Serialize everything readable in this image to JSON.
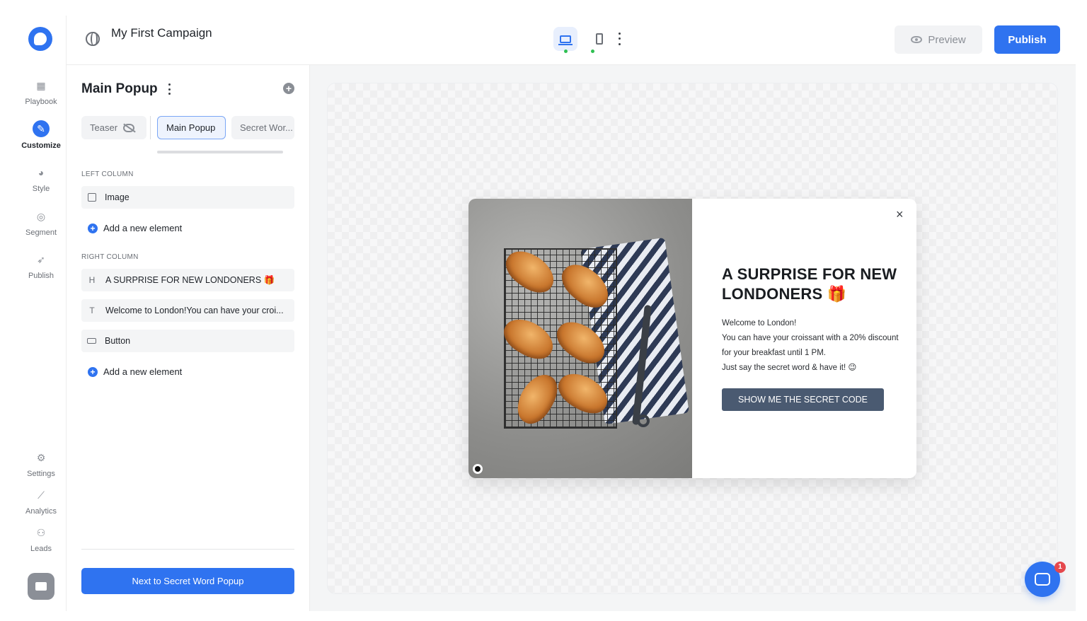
{
  "topbar": {
    "campaign_title": "My First Campaign",
    "preview_label": "Preview",
    "publish_label": "Publish"
  },
  "rail": {
    "items": [
      {
        "label": "Playbook",
        "icon": "grid-icon"
      },
      {
        "label": "Customize",
        "icon": "pencil-icon",
        "active": true
      },
      {
        "label": "Style",
        "icon": "palette-icon"
      },
      {
        "label": "Segment",
        "icon": "target-icon"
      },
      {
        "label": "Publish",
        "icon": "rocket-icon"
      },
      {
        "label": "Settings",
        "icon": "gear-icon"
      },
      {
        "label": "Analytics",
        "icon": "chart-line-icon"
      },
      {
        "label": "Leads",
        "icon": "users-icon"
      }
    ]
  },
  "panel": {
    "title": "Main Popup",
    "tabs": [
      {
        "label": "Teaser"
      },
      {
        "label": "Main Popup",
        "active": true
      },
      {
        "label": "Secret Wor..."
      }
    ],
    "left_column_label": "LEFT COLUMN",
    "left_elements": [
      {
        "label": "Image",
        "type": "image"
      }
    ],
    "add_element_label": "Add a new element",
    "right_column_label": "RIGHT COLUMN",
    "right_elements": [
      {
        "label": "A SURPRISE FOR NEW LONDONERS 🎁",
        "type": "heading",
        "icon": "H"
      },
      {
        "label": "Welcome to London!You can have your croi...",
        "type": "text",
        "icon": "T"
      },
      {
        "label": "Button",
        "type": "button"
      }
    ],
    "next_button_label": "Next to Secret Word Popup"
  },
  "popup": {
    "heading": "A SURPRISE FOR NEW LONDONERS 🎁",
    "body_lines": [
      "Welcome to London!",
      "You can have your croissant with a 20% discount for your breakfast until 1 PM.",
      "Just say the secret word & have it! 😉"
    ],
    "cta_label": "SHOW ME THE SECRET CODE",
    "close_glyph": "×"
  },
  "chat": {
    "badge_count": "1"
  },
  "colors": {
    "accent": "#2f73f0",
    "cta_bg": "#4a5a71",
    "status_green": "#2fbf52",
    "badge_red": "#e5484d"
  }
}
